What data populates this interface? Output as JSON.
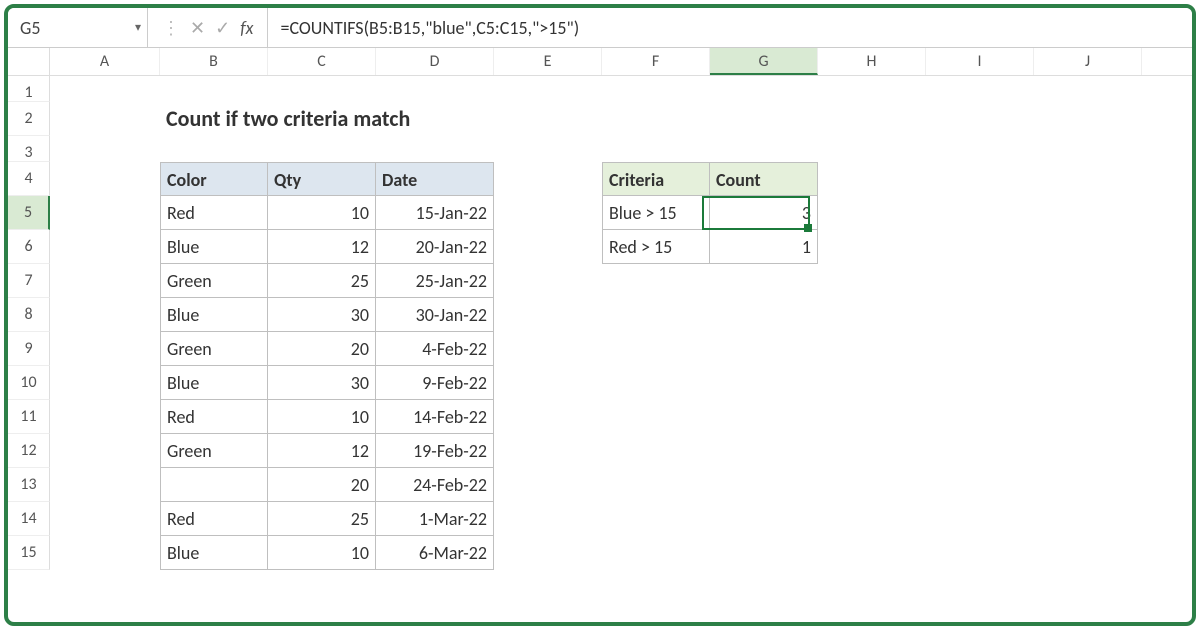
{
  "namebox": {
    "cell_ref": "G5"
  },
  "formula_bar": {
    "fx_label": "fx",
    "formula": "=COUNTIFS(B5:B15,\"blue\",C5:C15,\">15\")"
  },
  "columns": [
    "A",
    "B",
    "C",
    "D",
    "E",
    "F",
    "G",
    "H",
    "I",
    "J"
  ],
  "rows": [
    "1",
    "2",
    "3",
    "4",
    "5",
    "6",
    "7",
    "8",
    "9",
    "10",
    "11",
    "12",
    "13",
    "14",
    "15"
  ],
  "title": "Count if two criteria match",
  "main_table": {
    "headers": {
      "color": "Color",
      "qty": "Qty",
      "date": "Date"
    },
    "data": [
      {
        "color": "Red",
        "qty": "10",
        "date": "15-Jan-22"
      },
      {
        "color": "Blue",
        "qty": "12",
        "date": "20-Jan-22"
      },
      {
        "color": "Green",
        "qty": "25",
        "date": "25-Jan-22"
      },
      {
        "color": "Blue",
        "qty": "30",
        "date": "30-Jan-22"
      },
      {
        "color": "Green",
        "qty": "20",
        "date": "4-Feb-22"
      },
      {
        "color": "Blue",
        "qty": "30",
        "date": "9-Feb-22"
      },
      {
        "color": "Red",
        "qty": "10",
        "date": "14-Feb-22"
      },
      {
        "color": "Green",
        "qty": "12",
        "date": "19-Feb-22"
      },
      {
        "color": "",
        "qty": "20",
        "date": "24-Feb-22"
      },
      {
        "color": "Red",
        "qty": "25",
        "date": "1-Mar-22"
      },
      {
        "color": "Blue",
        "qty": "10",
        "date": "6-Mar-22"
      }
    ]
  },
  "result_table": {
    "headers": {
      "criteria": "Criteria",
      "count": "Count"
    },
    "data": [
      {
        "criteria": "Blue > 15",
        "count": "3"
      },
      {
        "criteria": "Red > 15",
        "count": "1"
      }
    ]
  },
  "selection": {
    "active_cell": "G5"
  }
}
